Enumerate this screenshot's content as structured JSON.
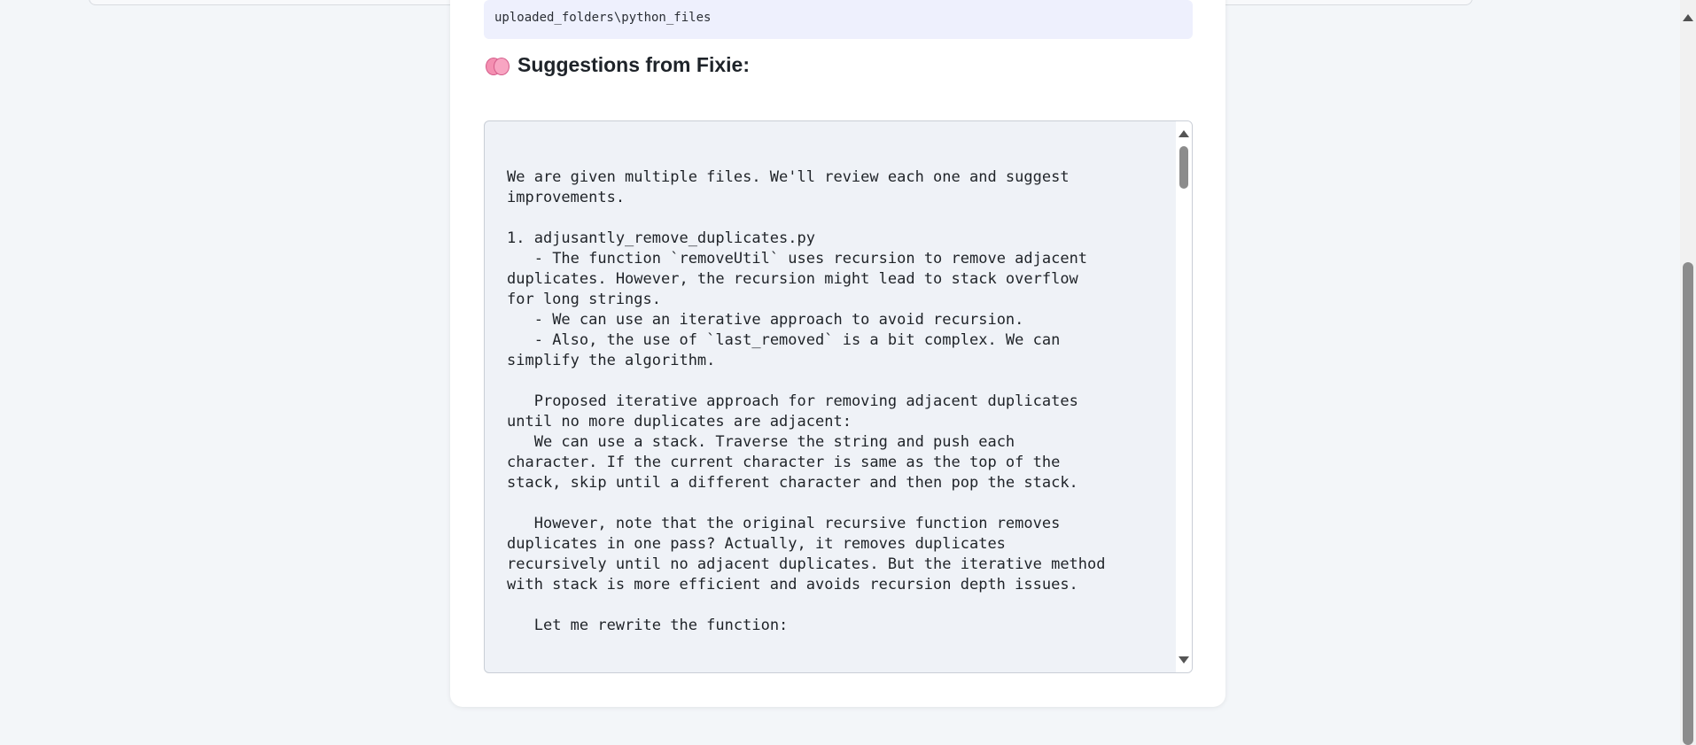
{
  "path_display": "uploaded_folders\\python_files",
  "suggestions": {
    "icon": "brain-icon",
    "title": "Suggestions from Fixie:",
    "text": "We are given multiple files. We'll review each one and suggest\nimprovements.\n\n1. adjusantly_remove_duplicates.py\n   - The function `removeUtil` uses recursion to remove adjacent\nduplicates. However, the recursion might lead to stack overflow\nfor long strings.\n   - We can use an iterative approach to avoid recursion.\n   - Also, the use of `last_removed` is a bit complex. We can\nsimplify the algorithm.\n\n   Proposed iterative approach for removing adjacent duplicates\nuntil no more duplicates are adjacent:\n   We can use a stack. Traverse the string and push each\ncharacter. If the current character is same as the top of the\nstack, skip until a different character and then pop the stack.\n\n   However, note that the original recursive function removes\nduplicates in one pass? Actually, it removes duplicates\nrecursively until no adjacent duplicates. But the iterative method\nwith stack is more efficient and avoids recursion depth issues.\n\n   Let me rewrite the function:"
  },
  "colors": {
    "page_background": "#f3f6f9",
    "card_background": "#ffffff",
    "path_box_background": "#eef0fd",
    "output_background": "#eff2f7"
  }
}
